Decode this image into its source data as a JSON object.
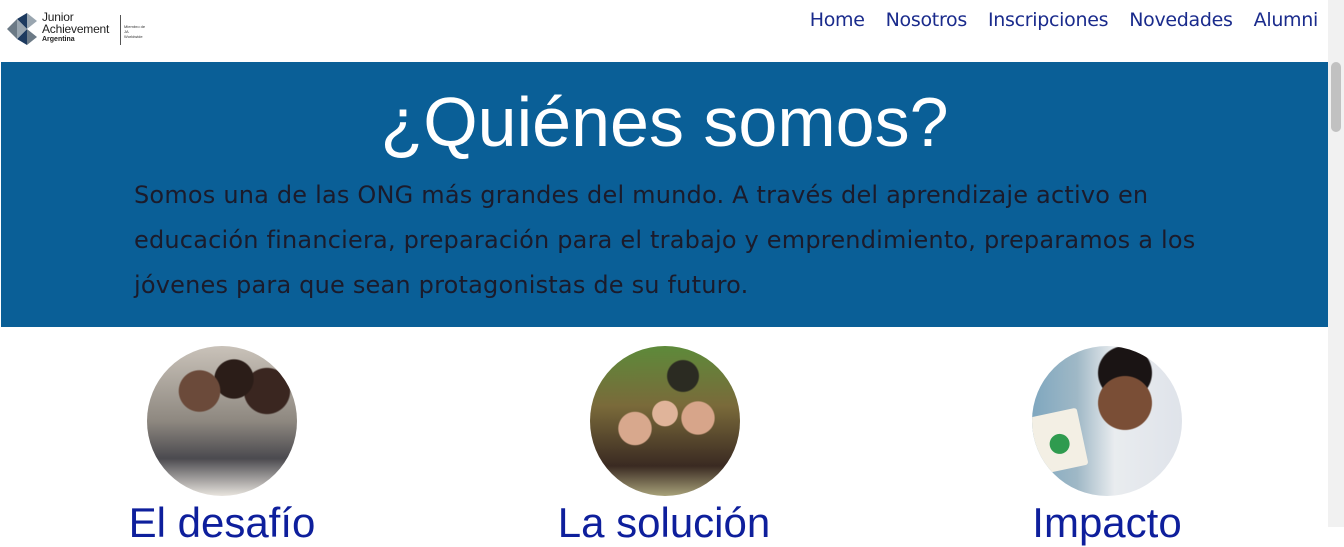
{
  "brand": {
    "line1": "Junior",
    "line2": "Achievement",
    "line3": "Argentina",
    "member_text": "Miembro de JA Worldwide",
    "logo_colors": [
      "#1d3a5f",
      "#6c7a86",
      "#9aa6b0"
    ]
  },
  "nav": {
    "items": [
      {
        "label": "Home"
      },
      {
        "label": "Nosotros"
      },
      {
        "label": "Inscripciones"
      },
      {
        "label": "Novedades"
      },
      {
        "label": "Alumni"
      }
    ]
  },
  "hero": {
    "title": "¿Quiénes somos?",
    "text": "Somos una de las ONG más grandes del mundo. A través del aprendizaje activo en educación financiera, preparación para el trabajo y emprendimiento, preparamos a los jóvenes para que sean protagonistas de su futuro.",
    "background": "#0a5f97"
  },
  "cards": [
    {
      "title": "El desafío",
      "photo": "students-working-at-table"
    },
    {
      "title": "La solución",
      "photo": "group-of-students-with-caps"
    },
    {
      "title": "Impacto",
      "photo": "student-holding-brochure"
    }
  ],
  "colors": {
    "nav_link": "#1a2b8c",
    "card_title": "#0e1f9c"
  }
}
